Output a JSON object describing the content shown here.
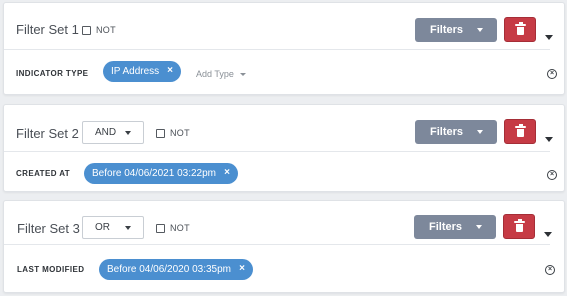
{
  "filter_sets": [
    {
      "title": "Filter Set 1",
      "operator": null,
      "not_label": "NOT",
      "not_checked": false,
      "filters_label": "Filters",
      "field_label": "INDICATOR TYPE",
      "value_pill": "IP Address",
      "add_type_label": "Add Type"
    },
    {
      "title": "Filter Set 2",
      "operator": "AND",
      "not_label": "NOT",
      "not_checked": false,
      "filters_label": "Filters",
      "field_label": "CREATED AT",
      "value_pill": "Before 04/06/2021 03:22pm"
    },
    {
      "title": "Filter Set 3",
      "operator": "OR",
      "not_label": "NOT",
      "not_checked": false,
      "filters_label": "Filters",
      "field_label": "LAST MODIFIED",
      "value_pill": "Before 04/06/2020 03:35pm"
    }
  ],
  "icons": {
    "remove_value": "×",
    "delete": "trash-icon",
    "more": "chevron-down-icon",
    "clear": "clear-circle-icon"
  },
  "colors": {
    "filters_button": "#7d889b",
    "delete_button": "#c63b45",
    "pill": "#4b8fd0"
  }
}
